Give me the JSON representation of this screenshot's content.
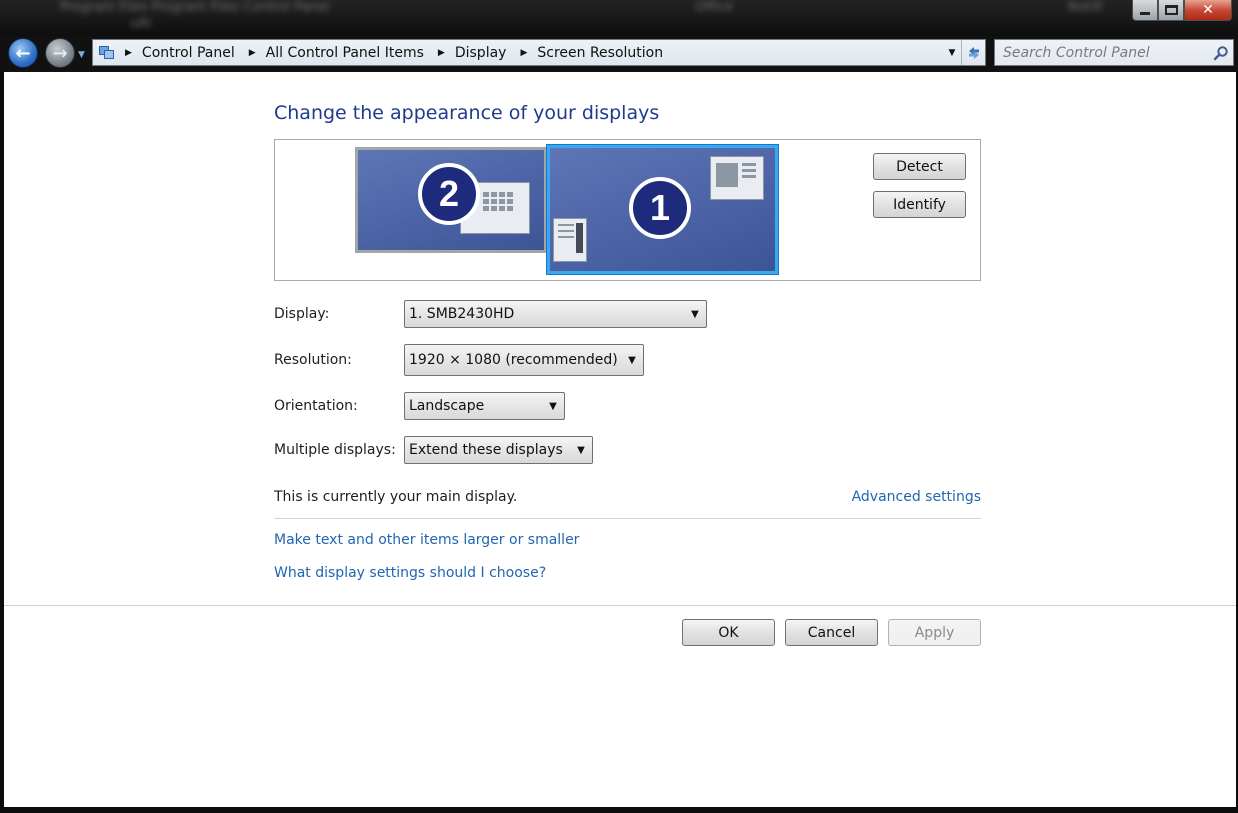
{
  "window": {
    "blurred_path": "Program Files Program Files Control Panel",
    "blurred_sub": "uAl",
    "blurred_center": "Office",
    "blurred_right": "Notifi",
    "close_glyph": "✕"
  },
  "nav": {
    "back_glyph": "←",
    "forward_glyph": "→",
    "breadcrumbs": [
      "Control Panel",
      "All Control Panel Items",
      "Display",
      "Screen Resolution"
    ],
    "search_placeholder": "Search Control Panel"
  },
  "page": {
    "heading": "Change the appearance of your displays",
    "monitors": [
      {
        "number": "2",
        "selected": false
      },
      {
        "number": "1",
        "selected": true
      }
    ],
    "detect_label": "Detect",
    "identify_label": "Identify",
    "display_label": "Display:",
    "display_value": "1. SMB2430HD",
    "resolution_label": "Resolution:",
    "resolution_value": "1920 × 1080 (recommended)",
    "orientation_label": "Orientation:",
    "orientation_value": "Landscape",
    "multiple_label": "Multiple displays:",
    "multiple_value": "Extend these displays",
    "main_display_text": "This is currently your main display.",
    "advanced_settings": "Advanced settings",
    "link_text_size": "Make text and other items larger or smaller",
    "link_help": "What display settings should I choose?",
    "ok_label": "OK",
    "cancel_label": "Cancel",
    "apply_label": "Apply"
  },
  "colors": {
    "heading": "#1f3b8f",
    "link": "#2066b2",
    "monitor_fill": "#4a62a6",
    "monitor_selected_border": "#39a8f3"
  }
}
